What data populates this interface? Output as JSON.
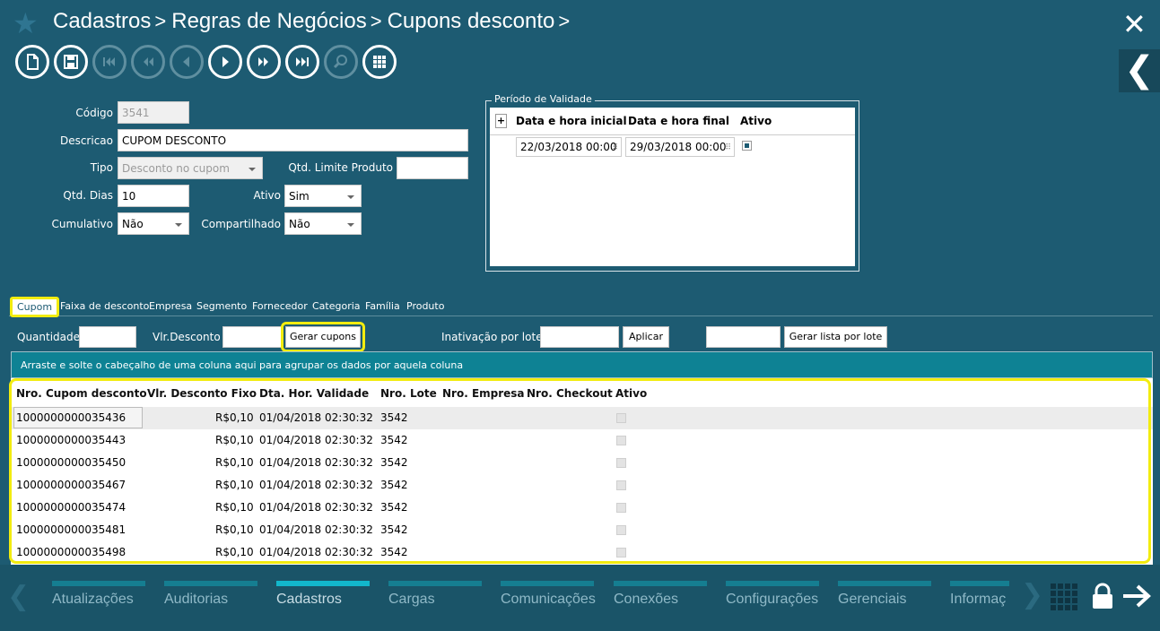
{
  "header": {
    "breadcrumb": [
      "Cadastros",
      "Regras de Negócios",
      "Cupons desconto"
    ],
    "separator": ">"
  },
  "toolbar": {
    "buttons": [
      {
        "name": "new-document-icon",
        "enabled": true
      },
      {
        "name": "save-icon",
        "enabled": true
      },
      {
        "name": "first-record-icon",
        "enabled": false
      },
      {
        "name": "previous-page-icon",
        "enabled": false
      },
      {
        "name": "previous-record-icon",
        "enabled": false
      },
      {
        "name": "next-record-icon",
        "enabled": true
      },
      {
        "name": "next-page-icon",
        "enabled": true
      },
      {
        "name": "last-record-icon",
        "enabled": true
      },
      {
        "name": "search-icon",
        "enabled": false
      },
      {
        "name": "grid-view-icon",
        "enabled": true
      }
    ]
  },
  "form": {
    "codigo_label": "Código",
    "codigo_value": "3541",
    "descricao_label": "Descricao",
    "descricao_value": "CUPOM DESCONTO",
    "tipo_label": "Tipo",
    "tipo_value": "Desconto no cupom",
    "qtd_limite_label": "Qtd. Limite Produto",
    "qtd_limite_value": "",
    "qtd_dias_label": "Qtd. Dias",
    "qtd_dias_value": "10",
    "ativo_label": "Ativo",
    "ativo_value": "Sim",
    "cumulativo_label": "Cumulativo",
    "cumulativo_value": "Não",
    "compartilhado_label": "Compartilhado",
    "compartilhado_value": "Não"
  },
  "periodo": {
    "legend": "Período de Validade",
    "add": "+",
    "col_inicial": "Data e hora inicial",
    "col_final": "Data e hora final",
    "col_ativo": "Ativo",
    "inicial_value": "22/03/2018 00:00",
    "final_value": "29/03/2018 00:00",
    "ativo_checked": true
  },
  "tabs": [
    {
      "label": "Cupom",
      "active": true
    },
    {
      "label": "Faixa de desconto",
      "active": false
    },
    {
      "label": "Empresa",
      "active": false
    },
    {
      "label": "Segmento",
      "active": false
    },
    {
      "label": "Fornecedor",
      "active": false
    },
    {
      "label": "Categoria",
      "active": false
    },
    {
      "label": "Família",
      "active": false
    },
    {
      "label": "Produto",
      "active": false
    }
  ],
  "actions": {
    "quantidade_label": "Quantidade",
    "quantidade_value": "",
    "vlr_desconto_label": "Vlr.Desconto",
    "vlr_desconto_value": "",
    "gerar_cupons": "Gerar cupons",
    "inativacao_label": "Inativação por lote",
    "inativacao_value": "",
    "aplicar": "Aplicar",
    "lote_value": "",
    "gerar_lista": "Gerar lista por lote"
  },
  "group_banner": "Arraste e solte o cabeçalho de uma coluna aqui para agrupar os dados por aquela coluna",
  "grid": {
    "columns": [
      "Nro. Cupom desconto",
      "Vlr. Desconto Fixo",
      "Dta. Hor. Validade",
      "Nro. Lote",
      "Nro. Empresa",
      "Nro. Checkout",
      "Ativo"
    ],
    "rows": [
      {
        "cupom": "1000000000035436",
        "valor": "R$0,10",
        "validade": "01/04/2018 02:30:32",
        "lote": "3542",
        "empresa": "",
        "checkout": ""
      },
      {
        "cupom": "1000000000035443",
        "valor": "R$0,10",
        "validade": "01/04/2018 02:30:32",
        "lote": "3542",
        "empresa": "",
        "checkout": ""
      },
      {
        "cupom": "1000000000035450",
        "valor": "R$0,10",
        "validade": "01/04/2018 02:30:32",
        "lote": "3542",
        "empresa": "",
        "checkout": ""
      },
      {
        "cupom": "1000000000035467",
        "valor": "R$0,10",
        "validade": "01/04/2018 02:30:32",
        "lote": "3542",
        "empresa": "",
        "checkout": ""
      },
      {
        "cupom": "1000000000035474",
        "valor": "R$0,10",
        "validade": "01/04/2018 02:30:32",
        "lote": "3542",
        "empresa": "",
        "checkout": ""
      },
      {
        "cupom": "1000000000035481",
        "valor": "R$0,10",
        "validade": "01/04/2018 02:30:32",
        "lote": "3542",
        "empresa": "",
        "checkout": ""
      },
      {
        "cupom": "1000000000035498",
        "valor": "R$0,10",
        "validade": "01/04/2018 02:30:32",
        "lote": "3542",
        "empresa": "",
        "checkout": ""
      }
    ]
  },
  "bottom_nav": {
    "items": [
      {
        "label": "Atualizações",
        "active": false
      },
      {
        "label": "Auditorias",
        "active": false
      },
      {
        "label": "Cadastros",
        "active": true
      },
      {
        "label": "Cargas",
        "active": false
      },
      {
        "label": "Comunicações",
        "active": false
      },
      {
        "label": "Conexões",
        "active": false
      },
      {
        "label": "Configurações",
        "active": false
      },
      {
        "label": "Gerenciais",
        "active": false
      },
      {
        "label": "Informaç",
        "active": false
      }
    ]
  },
  "colors": {
    "background": "#1d5b72",
    "highlight": "#f2ec0f",
    "banner": "#0e8294"
  }
}
